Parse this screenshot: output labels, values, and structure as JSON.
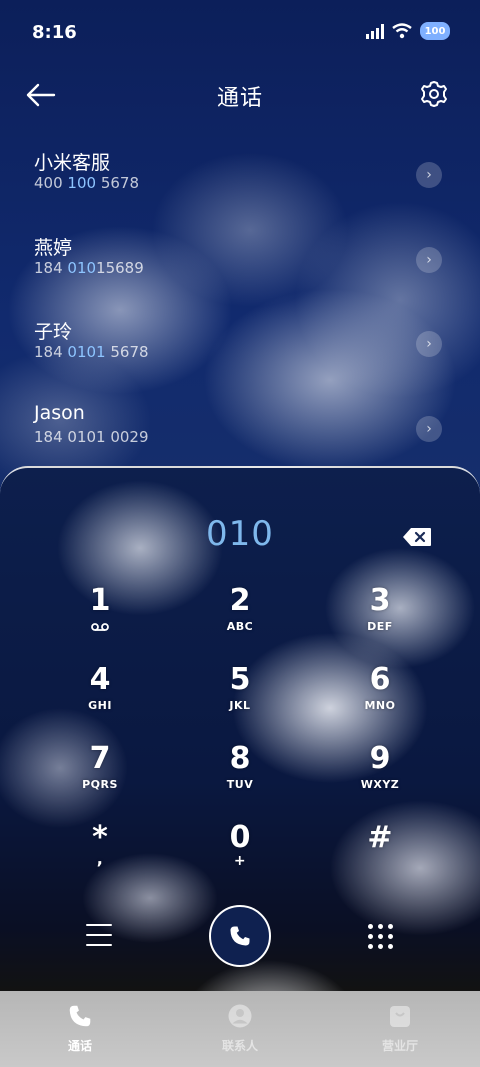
{
  "status_bar": {
    "time": "8:16",
    "battery": "100",
    "icons": [
      "signal-icon",
      "wifi-icon",
      "battery-icon"
    ]
  },
  "header": {
    "title": "通话",
    "back_icon": "arrow-left-icon",
    "settings_icon": "gear-icon"
  },
  "recent_calls": [
    {
      "name": "小米客服",
      "number_pre": "400 ",
      "number_hl": "100",
      "number_post": " 5678"
    },
    {
      "name": "燕婷",
      "number_pre": "184 ",
      "number_hl": "010",
      "number_post": "15689"
    },
    {
      "name": "子玲",
      "number_pre": "184 ",
      "number_hl": "0101",
      "number_post": " 5678"
    },
    {
      "name": "Jason",
      "number_pre": "184 0101 0029",
      "number_hl": "",
      "number_post": ""
    }
  ],
  "dialer": {
    "entered_digits": "010",
    "keys": [
      {
        "main": "1",
        "sub": "voicemail"
      },
      {
        "main": "2",
        "sub": "ABC"
      },
      {
        "main": "3",
        "sub": "DEF"
      },
      {
        "main": "4",
        "sub": "GHI"
      },
      {
        "main": "5",
        "sub": "JKL"
      },
      {
        "main": "6",
        "sub": "MNO"
      },
      {
        "main": "7",
        "sub": "PQRS"
      },
      {
        "main": "8",
        "sub": "TUV"
      },
      {
        "main": "9",
        "sub": "WXYZ"
      },
      {
        "main": "*",
        "sub": ","
      },
      {
        "main": "0",
        "sub": "+"
      },
      {
        "main": "#",
        "sub": ""
      }
    ]
  },
  "bottom_nav": [
    {
      "label": "通话",
      "icon": "phone-icon",
      "active": true
    },
    {
      "label": "联系人",
      "icon": "person-icon",
      "active": false
    },
    {
      "label": "营业厅",
      "icon": "bag-icon",
      "active": false
    }
  ],
  "colors": {
    "highlight": "#8ec5ff",
    "digits": "#7fb8ec",
    "call_button": "#0f2150",
    "nav_background": "#bdbdbd"
  }
}
